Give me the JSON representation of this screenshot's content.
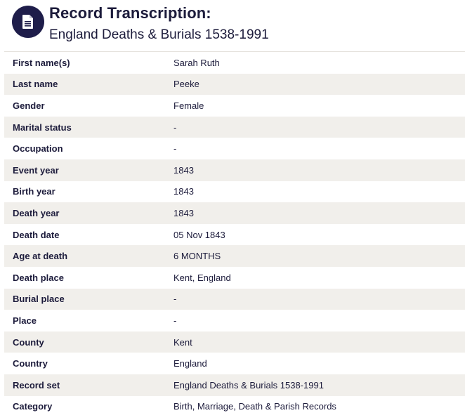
{
  "header": {
    "icon": "document-icon",
    "title": "Record Transcription:",
    "subtitle": "England Deaths & Burials 1538-1991"
  },
  "colors": {
    "icon_background": "#1e1d4a",
    "text": "#1c1b3b",
    "row_stripe": "#f1efeb"
  },
  "rows": [
    {
      "label": "First name(s)",
      "value": "Sarah Ruth"
    },
    {
      "label": "Last name",
      "value": "Peeke"
    },
    {
      "label": "Gender",
      "value": "Female"
    },
    {
      "label": "Marital status",
      "value": "-"
    },
    {
      "label": "Occupation",
      "value": "-"
    },
    {
      "label": "Event year",
      "value": "1843"
    },
    {
      "label": "Birth year",
      "value": "1843"
    },
    {
      "label": "Death year",
      "value": "1843"
    },
    {
      "label": "Death date",
      "value": "05 Nov 1843"
    },
    {
      "label": "Age at death",
      "value": "6 MONTHS"
    },
    {
      "label": "Death place",
      "value": "Kent, England"
    },
    {
      "label": "Burial place",
      "value": "-"
    },
    {
      "label": "Place",
      "value": "-"
    },
    {
      "label": "County",
      "value": "Kent"
    },
    {
      "label": "Country",
      "value": "England"
    },
    {
      "label": "Record set",
      "value": "England Deaths & Burials 1538-1991"
    },
    {
      "label": "Category",
      "value": "Birth, Marriage, Death & Parish Records"
    }
  ]
}
